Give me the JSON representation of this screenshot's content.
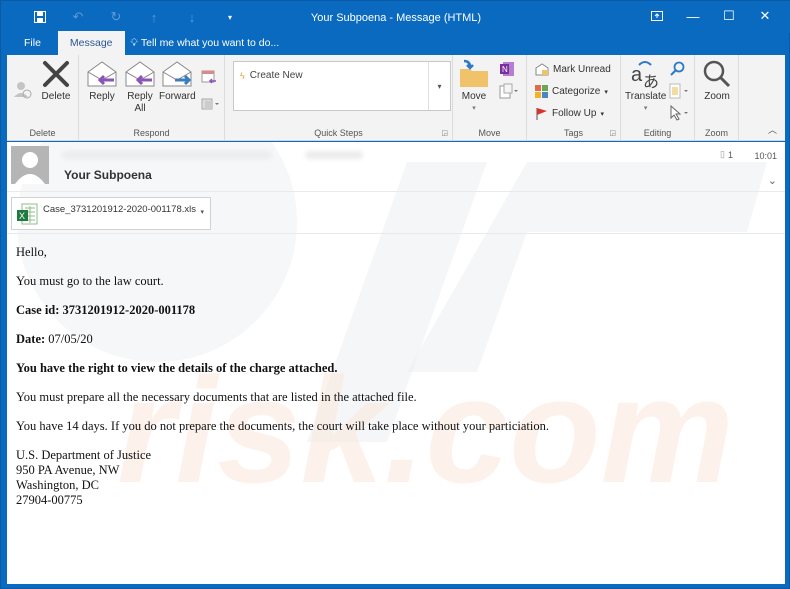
{
  "window": {
    "title": "Your Subpoena - Message (HTML)",
    "accent_color": "#0a6ac0"
  },
  "quick_access": [
    {
      "icon": "save-icon"
    },
    {
      "icon": "undo-icon"
    },
    {
      "icon": "redo-icon"
    },
    {
      "icon": "previous-item-icon"
    },
    {
      "icon": "next-item-icon"
    },
    {
      "icon": "customize-toolbar-icon"
    }
  ],
  "tabs": {
    "file": "File",
    "message": "Message",
    "tell_me": "Tell me what you want to do..."
  },
  "ribbon": {
    "delete_group": {
      "label": "Delete",
      "delete_button": "Delete"
    },
    "respond_group": {
      "label": "Respond",
      "reply": "Reply",
      "reply_all_line1": "Reply",
      "reply_all_line2": "All",
      "forward": "Forward"
    },
    "quick_steps_group": {
      "label": "Quick Steps",
      "create_new": "Create New"
    },
    "move_group": {
      "label": "Move",
      "move_button": "Move"
    },
    "tags_group": {
      "label": "Tags",
      "mark_unread": "Mark Unread",
      "categorize": "Categorize",
      "follow_up": "Follow Up"
    },
    "editing_group": {
      "label": "Editing",
      "translate": "Translate"
    },
    "zoom_group": {
      "label": "Zoom",
      "zoom_button": "Zoom"
    }
  },
  "message": {
    "subject": "Your Subpoena",
    "attachment_count": "1",
    "time": "10:01",
    "attachment": {
      "filename": "Case_3731201912-2020-001178.xls"
    },
    "body": {
      "greeting": "Hello,",
      "line1": "You must go to the law court.",
      "case_label": "Case id: 3731201912-2020-001178",
      "date_label": "Date:",
      "date_value": "07/05/20",
      "rights": "You have the right to view the details of the charge attached.",
      "line2": "You must prepare all the necessary documents that are listed in the attached file.",
      "line3": "You have 14 days. If you do not prepare the documents, the court will take place without your particiation.",
      "signature": [
        "U.S. Department of Justice",
        "950 PA Avenue, NW",
        "Washington, DC",
        "27904-00775"
      ]
    }
  },
  "watermark": {
    "text": "risk.com"
  }
}
